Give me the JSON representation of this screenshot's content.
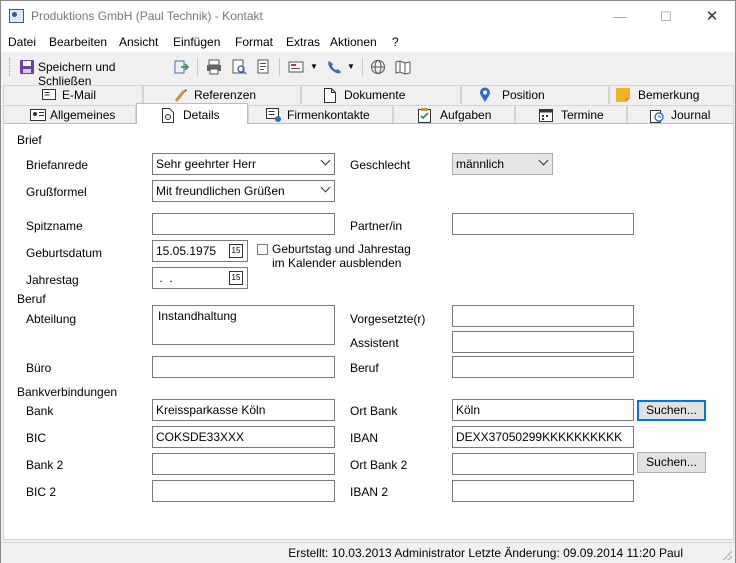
{
  "window": {
    "title": "Produktions GmbH (Paul Technik) - Kontakt"
  },
  "menu": [
    "Datei",
    "Bearbeiten",
    "Ansicht",
    "Einfügen",
    "Format",
    "Extras",
    "Aktionen",
    "?"
  ],
  "toolbar": {
    "save_label": "Speichern und Schließen"
  },
  "tabs_top": [
    "E-Mail",
    "Referenzen",
    "Dokumente",
    "Position",
    "Bemerkung"
  ],
  "tabs_bottom": [
    "Allgemeines",
    "Details",
    "Firmenkontakte",
    "Aufgaben",
    "Termine",
    "Journal"
  ],
  "active_tab": "Details",
  "sections": {
    "brief": "Brief",
    "beruf": "Beruf",
    "bank": "Bankverbindungen"
  },
  "labels": {
    "briefanrede": "Briefanrede",
    "grussformel": "Grußformel",
    "spitzname": "Spitzname",
    "geburtsdatum": "Geburtsdatum",
    "jahrestag": "Jahrestag",
    "geschlecht": "Geschlecht",
    "partner": "Partner/in",
    "checkbox": "Geburtstag und Jahrestag\nim Kalender ausblenden",
    "abteilung": "Abteilung",
    "buero": "Büro",
    "vorgesetzter": "Vorgesetzte(r)",
    "assistent": "Assistent",
    "beruf": "Beruf",
    "bank": "Bank",
    "bic": "BIC",
    "bank2": "Bank 2",
    "bic2": "BIC 2",
    "ortbank": "Ort Bank",
    "iban": "IBAN",
    "ortbank2": "Ort Bank 2",
    "iban2": "IBAN 2"
  },
  "values": {
    "briefanrede": "Sehr geehrter Herr",
    "grussformel": "Mit freundlichen Grüßen",
    "spitzname": "",
    "geburtsdatum": "15.05.1975",
    "jahrestag": " .  .",
    "geschlecht": "männlich",
    "partner": "",
    "abteilung": "Instandhaltung",
    "buero": "",
    "vorgesetzter": "",
    "assistent": "",
    "beruf": "",
    "bank": "Kreissparkasse Köln",
    "bic": "COKSDE33XXX",
    "bank2": "",
    "bic2": "",
    "ortbank": "Köln",
    "iban": "DEXX37050299KKKKKKKKKK",
    "ortbank2": "",
    "iban2": ""
  },
  "buttons": {
    "suchen": "Suchen..."
  },
  "calendar_icon_text": "15",
  "status": "Erstellt: 10.03.2013 Administrator  Letzte Änderung: 09.09.2014 11:20 Paul"
}
